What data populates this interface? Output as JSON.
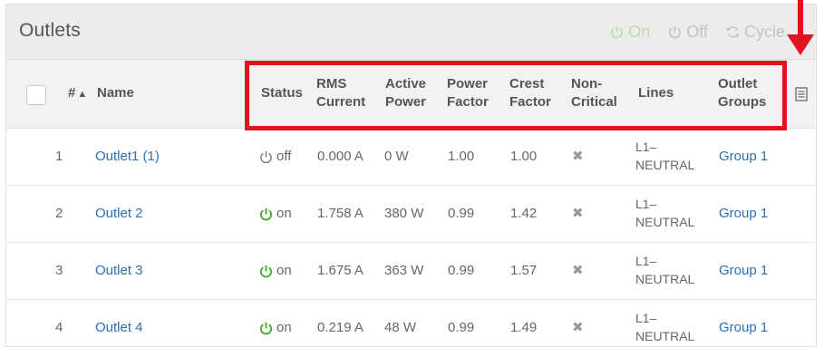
{
  "page": {
    "title": "Outlets"
  },
  "toolbar": {
    "on_label": "On",
    "off_label": "Off",
    "cycle_label": "Cycle"
  },
  "columns": {
    "number": "#",
    "name": "Name",
    "status": "Status",
    "rms_current_1": "RMS",
    "rms_current_2": "Current",
    "active_power_1": "Active",
    "active_power_2": "Power",
    "power_factor_1": "Power",
    "power_factor_2": "Factor",
    "crest_factor_1": "Crest",
    "crest_factor_2": "Factor",
    "non_critical_1": "Non-",
    "non_critical_2": "Critical",
    "lines": "Lines",
    "outlet_groups_1": "Outlet",
    "outlet_groups_2": "Groups"
  },
  "rows": [
    {
      "num": "1",
      "name": "Outlet1 (1)",
      "status": "off",
      "rms": "0.000 A",
      "active": "0 W",
      "pf": "1.00",
      "crest": "1.00",
      "lines_1": "L1–",
      "lines_2": "NEUTRAL",
      "group": "Group 1"
    },
    {
      "num": "2",
      "name": "Outlet 2",
      "status": "on",
      "rms": "1.758 A",
      "active": "380 W",
      "pf": "0.99",
      "crest": "1.42",
      "lines_1": "L1–",
      "lines_2": "NEUTRAL",
      "group": "Group 1"
    },
    {
      "num": "3",
      "name": "Outlet 3",
      "status": "on",
      "rms": "1.675 A",
      "active": "363 W",
      "pf": "0.99",
      "crest": "1.57",
      "lines_1": "L1–",
      "lines_2": "NEUTRAL",
      "group": "Group 1"
    },
    {
      "num": "4",
      "name": "Outlet 4",
      "status": "on",
      "rms": "0.219 A",
      "active": "48 W",
      "pf": "0.99",
      "crest": "1.49",
      "lines_1": "L1–",
      "lines_2": "NEUTRAL",
      "group": "Group 1"
    }
  ],
  "icons": {
    "power_on_color": "#44a832",
    "power_off_color": "#777777",
    "highlight_color": "#e0131e",
    "link_color": "#2f6fb0"
  }
}
